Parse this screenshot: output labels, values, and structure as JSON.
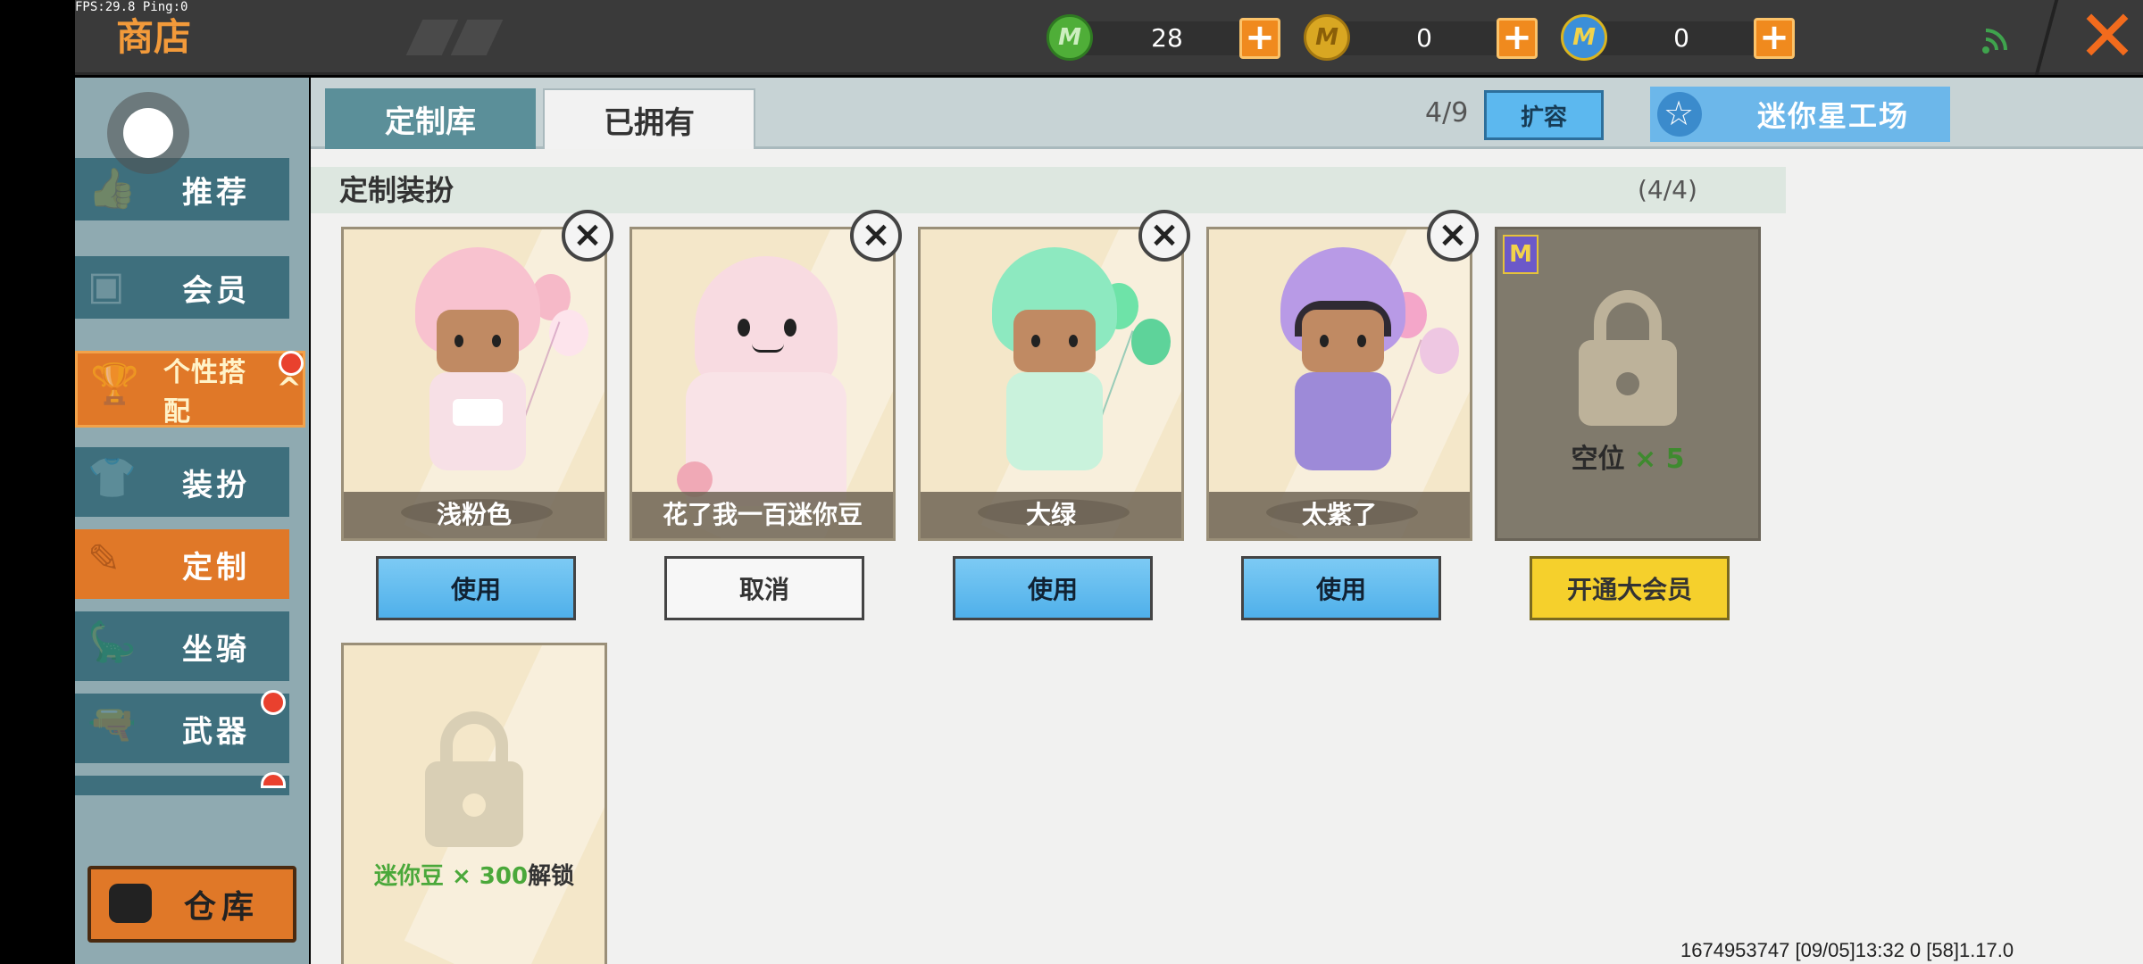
{
  "debug": {
    "fps_ping": "FPS:29.8  Ping:0"
  },
  "header": {
    "title": "商店",
    "currencies": [
      {
        "icon": "green-gem-icon",
        "value": "28",
        "color": "#4fae38"
      },
      {
        "icon": "gold-coin-icon",
        "value": "0",
        "color": "#d9a722"
      },
      {
        "icon": "blue-m-coin-icon",
        "value": "0",
        "color": "#3b8fd9"
      }
    ],
    "plus": "+",
    "close": "✕"
  },
  "sidebar": {
    "items": [
      {
        "label": "推荐",
        "icon": "thumbs-up-icon"
      },
      {
        "label": "会员",
        "icon": "vip-card-icon"
      },
      {
        "label": "个性搭配",
        "icon": "trophy-icon",
        "expanded_marker": "^"
      },
      {
        "label": "装扮",
        "icon": "shirt-icon"
      },
      {
        "label": "定制",
        "icon": "pencil-ruler-icon"
      },
      {
        "label": "坐骑",
        "icon": "mount-icon"
      },
      {
        "label": "武器",
        "icon": "revolver-icon"
      }
    ],
    "warehouse_label": "仓库"
  },
  "tabs": {
    "library": "定制库",
    "owned": "已拥有"
  },
  "toolbar": {
    "slots": "4/9",
    "expand": "扩容",
    "workshop": "迷你星工场"
  },
  "section": {
    "title": "定制装扮",
    "count": "(4/4)"
  },
  "cards": [
    {
      "name": "浅粉色",
      "action": "使用"
    },
    {
      "name": "花了我一百迷你豆",
      "action": "取消"
    },
    {
      "name": "大绿",
      "action": "使用"
    },
    {
      "name": "太紫了",
      "action": "使用"
    }
  ],
  "vip_slot": {
    "label": "空位",
    "times": "× 5",
    "action": "开通大会员"
  },
  "unlock_slot": {
    "currency": "迷你豆",
    "times": "× 300",
    "suffix": "解锁"
  },
  "build_info": "1674953747   [09/05]13:32 0  [58]1.17.0"
}
